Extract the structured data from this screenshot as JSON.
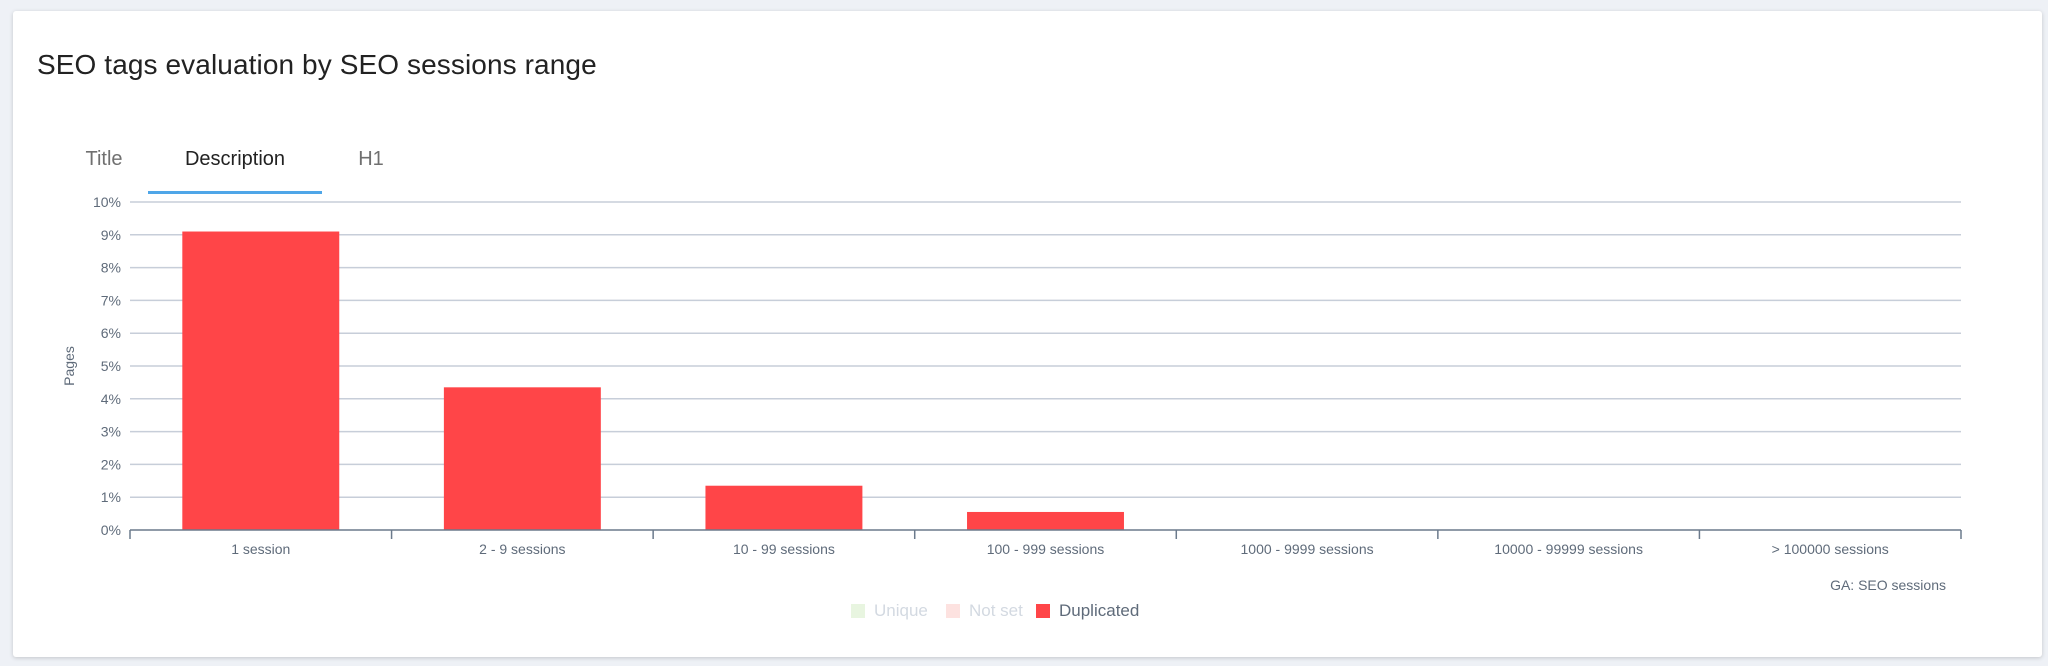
{
  "card": {
    "title": "SEO tags evaluation by SEO sessions range"
  },
  "tabs": [
    {
      "label": "Title",
      "active": false
    },
    {
      "label": "Description",
      "active": true
    },
    {
      "label": "H1",
      "active": false
    }
  ],
  "chart_data": {
    "type": "bar",
    "categories": [
      "1 session",
      "2 - 9 sessions",
      "10 - 99 sessions",
      "100 - 999 sessions",
      "1000 - 9999 sessions",
      "10000 - 99999 sessions",
      "> 100000 sessions"
    ],
    "series": [
      {
        "name": "Unique",
        "values": [
          0,
          0,
          0,
          0,
          0,
          0,
          0
        ],
        "color": "#e8f5e0",
        "visible": false
      },
      {
        "name": "Not set",
        "values": [
          0,
          0,
          0,
          0,
          0,
          0,
          0
        ],
        "color": "#fde2e0",
        "visible": false
      },
      {
        "name": "Duplicated",
        "values": [
          9.1,
          4.35,
          1.35,
          0.55,
          0,
          0,
          0
        ],
        "color": "#ff4548",
        "visible": true
      }
    ],
    "xlabel": "GA: SEO sessions",
    "ylabel": "Pages",
    "ylim": [
      0,
      10
    ],
    "yticks": [
      "0%",
      "1%",
      "2%",
      "3%",
      "4%",
      "5%",
      "6%",
      "7%",
      "8%",
      "9%",
      "10%"
    ],
    "grid": true,
    "legend_position": "bottom-center",
    "colors": {
      "grid": "#c7ced9",
      "axis": "#6b7a8c",
      "label": "#5f6b7a",
      "legend_hidden": "#d3d9e1",
      "legend_visible": "#5f6b7a"
    }
  }
}
